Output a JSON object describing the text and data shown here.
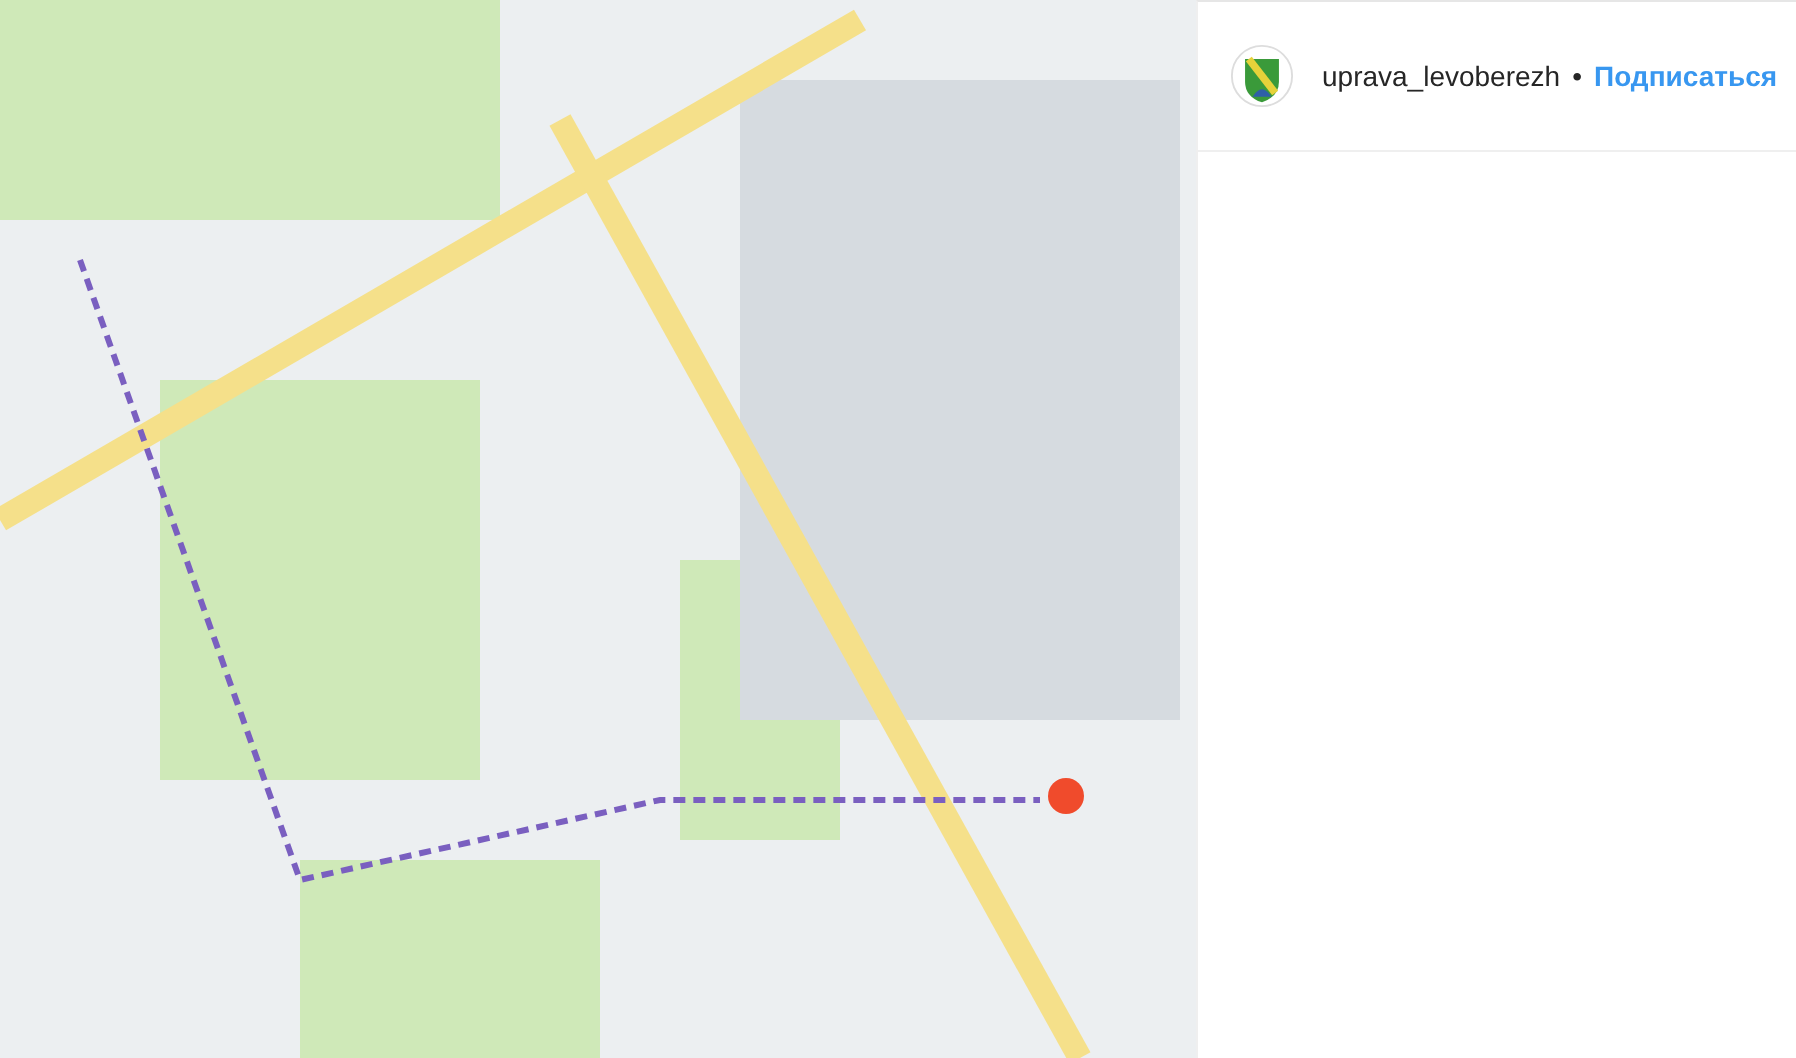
{
  "post": {
    "author": {
      "username": "uprava_levoberezh",
      "separator": "•",
      "follow_label": "Подписаться"
    }
  }
}
